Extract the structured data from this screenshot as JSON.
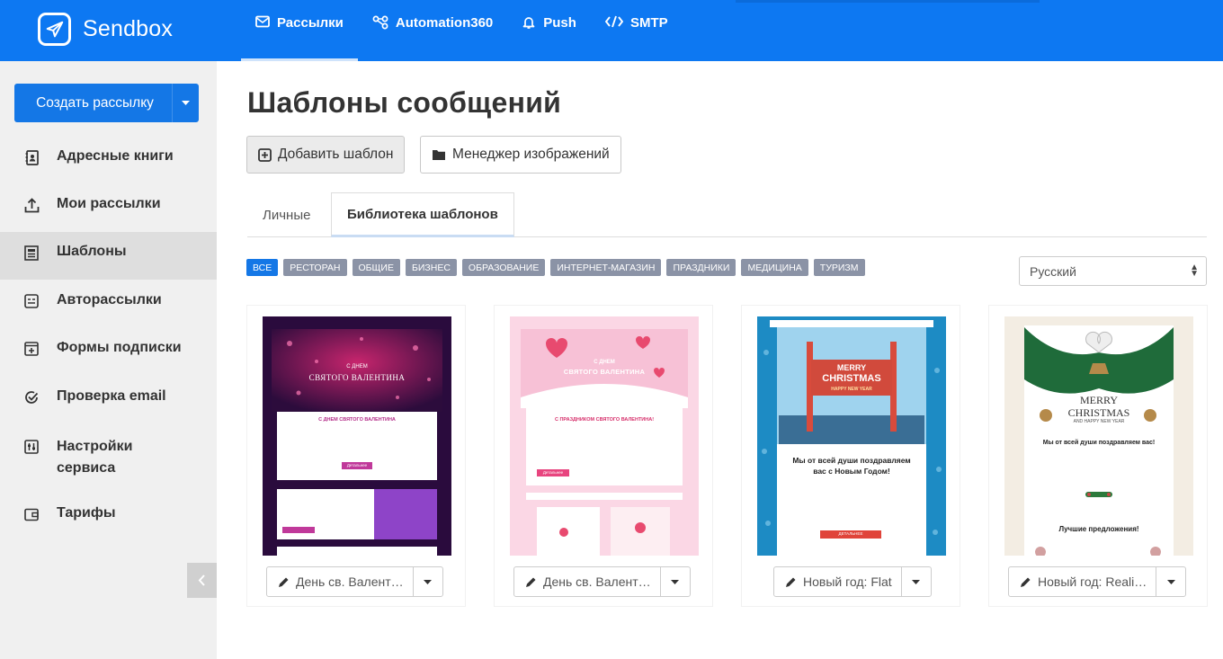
{
  "app": {
    "name": "Sendbox"
  },
  "nav": [
    {
      "label": "Рассылки",
      "icon": "mail-icon"
    },
    {
      "label": "Automation360",
      "icon": "workflow-icon"
    },
    {
      "label": "Push",
      "icon": "bell-icon"
    },
    {
      "label": "SMTP",
      "icon": "code-icon"
    }
  ],
  "sidebar": {
    "create_label": "Создать рассылку",
    "items": [
      {
        "label": "Адресные книги",
        "icon": "address-book-icon"
      },
      {
        "label": "Мои рассылки",
        "icon": "upload-icon"
      },
      {
        "label": "Шаблоны",
        "icon": "template-icon"
      },
      {
        "label": "Авторассылки",
        "icon": "autoresponder-icon"
      },
      {
        "label": "Формы подписки",
        "icon": "form-icon"
      },
      {
        "label": "Проверка email",
        "icon": "check-icon"
      },
      {
        "label": "Настройки сервиса",
        "icon": "settings-icon"
      },
      {
        "label": "Тарифы",
        "icon": "wallet-icon"
      }
    ]
  },
  "main": {
    "title": "Шаблоны сообщений",
    "add_template": "Добавить шаблон",
    "image_manager": "Менеджер изображений",
    "tabs": [
      {
        "label": "Личные"
      },
      {
        "label": "Библиотека шаблонов"
      }
    ],
    "categories": [
      "ВСЕ",
      "РЕСТОРАН",
      "ОБЩИЕ",
      "БИЗНЕС",
      "ОБРАЗОВАНИЕ",
      "ИНТЕРНЕТ-МАГАЗИН",
      "ПРАЗДНИКИ",
      "МЕДИЦИНА",
      "ТУРИЗМ"
    ],
    "language": "Русский",
    "templates": [
      {
        "name": "День св. Валент…",
        "banner_small": "С ДНЕМ",
        "banner_big": "СВЯТОГО ВАЛЕНТИНА",
        "heading": "С ДНЕМ СВЯТОГО ВАЛЕНТИНА",
        "button": "Детальнее"
      },
      {
        "name": "День св. Валент…",
        "banner_small": "С ДНЕМ",
        "banner_big": "СВЯТОГО ВАЛЕНТИНА",
        "heading": "С ПРАЗДНИКОМ СВЯТОГО ВАЛЕНТИНА!",
        "button": "Детальнее"
      },
      {
        "name": "Новый год: Flat",
        "sign_1": "MERRY",
        "sign_2": "CHRISTMAS",
        "sign_3": "HAPPY NEW YEAR",
        "heading": "Мы от всей души поздравляем вас с Новым Годом!",
        "button": "ДЕТАЛЬНЕЕ"
      },
      {
        "name": "Новый год: Reali…",
        "sign_1": "MERRY",
        "sign_2": "CHRISTMAS",
        "sign_3": "AND HAPPY NEW YEAR",
        "heading": "Мы от всей души поздравляем вас!",
        "offers": "Лучшие предложения!"
      }
    ]
  },
  "colors": {
    "brand": "#0d78f2",
    "chip": "#8b93a6",
    "chip_active": "#1477e6"
  }
}
